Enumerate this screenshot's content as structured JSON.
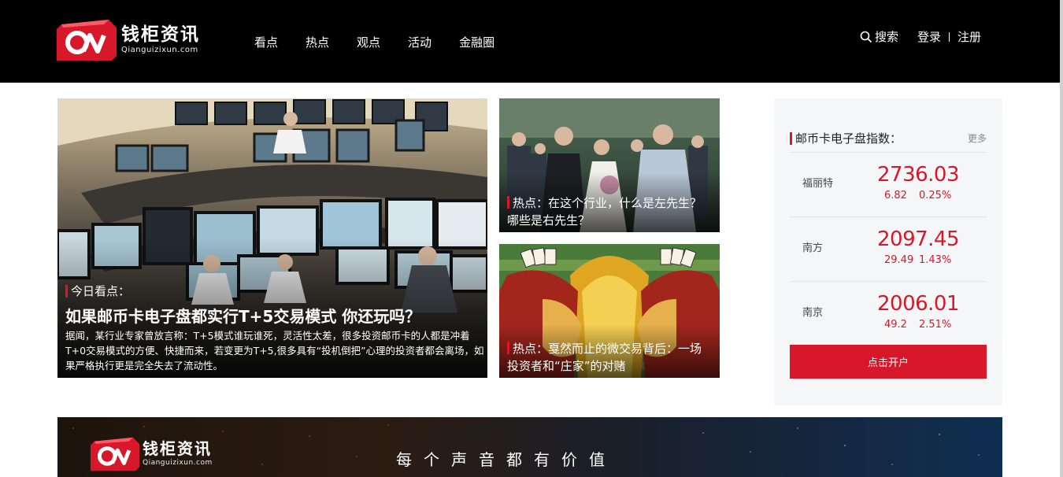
{
  "header": {
    "logo_cn": "钱柜资讯",
    "logo_en": "Qianguizixun.com",
    "nav": [
      "看点",
      "热点",
      "观点",
      "活动",
      "金融圈"
    ],
    "search_label": "搜索",
    "login_label": "登录",
    "register_label": "注册"
  },
  "feature": {
    "tag": "今日看点：",
    "title": "如果邮币卡电子盘都实行T+5交易模式 你还玩吗？",
    "description": "据闻，某行业专家曾放言称：T+5模式谁玩谁死，灵活性太差，很多投资邮币卡的人都是冲着T+0交易模式的方便、快捷而来，若变更为T+5,很多具有“投机倒把”心理的投资者都会离场，如果严格执行更是完全失去了流动性。"
  },
  "side_cards": [
    {
      "title": "热点：在这个行业，什么是左先生？哪些是右先生？"
    },
    {
      "title": "热点：戛然而止的微交易背后：一场投资者和“庄家”的对赌"
    }
  ],
  "index_panel": {
    "title": "邮币卡电子盘指数：",
    "more_label": "更多",
    "rows": [
      {
        "name": "福丽特",
        "value": "2736.03",
        "change": "6.82",
        "percent": "0.25%"
      },
      {
        "name": "南方",
        "value": "2097.45",
        "change": "29.49",
        "percent": "1.43%"
      },
      {
        "name": "南京",
        "value": "2006.01",
        "change": "49.2",
        "percent": "2.51%"
      }
    ],
    "open_account_label": "点击开户"
  },
  "banner": {
    "logo_cn": "钱柜资讯",
    "logo_en": "Qianguizixun.com",
    "slogan": "每个声音都有价值"
  },
  "colors": {
    "accent": "#d7182a",
    "header_bg": "#000000",
    "panel_bg": "#f5f6f7"
  }
}
